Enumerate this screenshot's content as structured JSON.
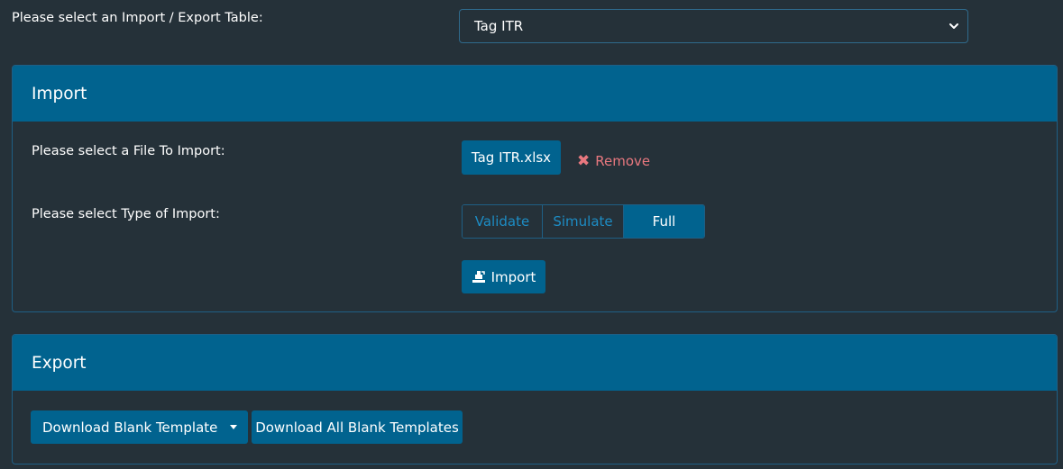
{
  "top": {
    "label": "Please select an Import / Export Table:",
    "selected_table": "Tag ITR"
  },
  "import_panel": {
    "title": "Import",
    "file_label": "Please select a File To Import:",
    "file_name": "Tag ITR.xlsx",
    "remove_label": "Remove",
    "type_label": "Please select Type of Import:",
    "import_types": [
      "Validate",
      "Simulate",
      "Full"
    ],
    "selected_type": "Full",
    "import_button": "Import"
  },
  "export_panel": {
    "title": "Export",
    "download_blank": "Download Blank Template",
    "download_all": "Download All Blank Templates"
  },
  "colors": {
    "background": "#253139",
    "accent": "#01638f",
    "remove": "#e8787f",
    "segment_text": "#1d8cc4"
  }
}
